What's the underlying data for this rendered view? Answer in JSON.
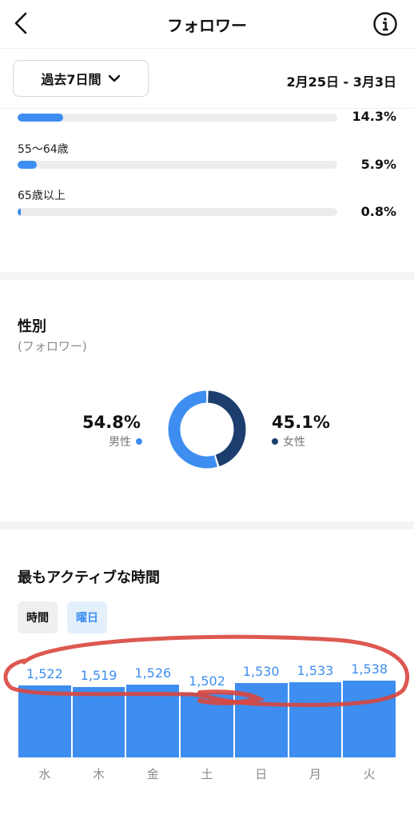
{
  "header": {
    "title": "フォロワー",
    "back_icon": "chevron-left-icon",
    "info_icon": "info-icon"
  },
  "range": {
    "selected": "過去7日間",
    "dates": "2月25日 - 3月3日"
  },
  "age": {
    "rows": [
      {
        "label": "",
        "percent": "14.3%",
        "value": 0.143
      },
      {
        "label": "55〜64歳",
        "percent": "5.9%",
        "value": 0.059
      },
      {
        "label": "65歳以上",
        "percent": "0.8%",
        "value": 0.008
      }
    ]
  },
  "gender": {
    "title": "性別",
    "subtitle": "(フォロワー)",
    "male": {
      "percent": "54.8%",
      "label": "男性",
      "value": 54.8,
      "color": "#3d8ef0"
    },
    "female": {
      "percent": "45.1%",
      "label": "女性",
      "value": 45.1,
      "color": "#1c3e6e"
    }
  },
  "active": {
    "title": "最もアクティブな時間",
    "toggle_hours": "時間",
    "toggle_days": "曜日",
    "selected_toggle": "曜日"
  },
  "chart_data": {
    "type": "bar",
    "categories": [
      "水",
      "木",
      "金",
      "土",
      "日",
      "月",
      "火"
    ],
    "values": [
      1522,
      1519,
      1526,
      1502,
      1530,
      1533,
      1538
    ],
    "value_labels": [
      "1,522",
      "1,519",
      "1,526",
      "1,502",
      "1,530",
      "1,533",
      "1,538"
    ],
    "color": "#3d8ef0"
  },
  "annotation": {
    "color": "#d9463e"
  }
}
